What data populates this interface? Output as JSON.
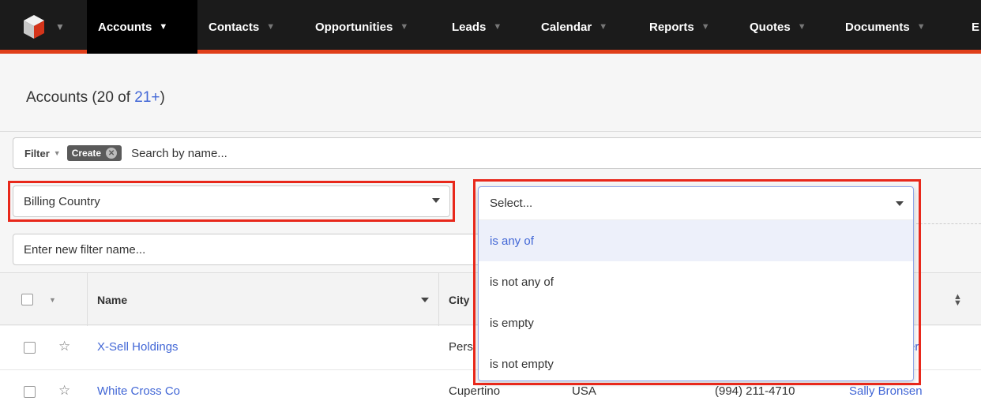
{
  "nav": {
    "items": [
      {
        "label": "Accounts"
      },
      {
        "label": "Contacts"
      },
      {
        "label": "Opportunities"
      },
      {
        "label": "Leads"
      },
      {
        "label": "Calendar"
      },
      {
        "label": "Reports"
      },
      {
        "label": "Quotes"
      },
      {
        "label": "Documents"
      },
      {
        "label": "E"
      }
    ],
    "active_index": 0
  },
  "header": {
    "title_prefix": "Accounts (20 of ",
    "title_link": "21+",
    "title_suffix": ")"
  },
  "filter": {
    "filter_label": "Filter",
    "create_pill": "Create",
    "search_placeholder": "Search by name...",
    "field_value": "Billing Country",
    "name_placeholder": "Enter new filter name..."
  },
  "operator": {
    "placeholder": "Select...",
    "options": [
      "is any of",
      "is not any of",
      "is empty",
      "is not empty"
    ],
    "highlighted_index": 0
  },
  "table": {
    "headers": {
      "name": "Name",
      "city": "City"
    },
    "rows": [
      {
        "name": "X-Sell Holdings",
        "city": "Pers",
        "country": "",
        "phone": "",
        "user": "er"
      },
      {
        "name": "White Cross Co",
        "city": "Cupertino",
        "country": "USA",
        "phone": "(994) 211-4710",
        "user": "Sally Bronsen"
      }
    ]
  },
  "colors": {
    "nav_bg": "#1b1b1b",
    "nav_accent": "#e03f1a",
    "link": "#4267d6",
    "highlight_box": "#e8281b"
  }
}
